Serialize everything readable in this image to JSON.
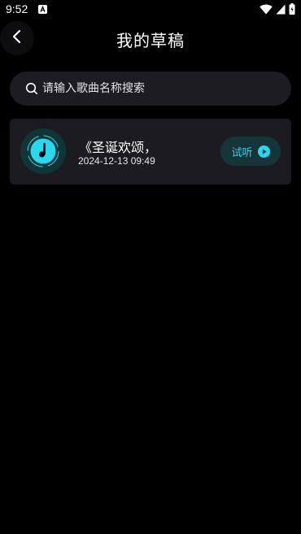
{
  "status_bar": {
    "time": "9:52",
    "app_icon": "a-box-icon",
    "indicators": [
      "wifi-icon",
      "signal-icon",
      "battery-icon"
    ]
  },
  "header": {
    "title": "我的草稿",
    "back_icon": "chevron-left-icon"
  },
  "search": {
    "placeholder": "请输入歌曲名称搜索",
    "value": "",
    "icon": "search-icon"
  },
  "drafts": [
    {
      "title": "《圣诞欢颂，",
      "date": "2024-12-13 09:49",
      "listen_label": "试听",
      "cover_icon": "music-disc-icon",
      "action_icon": "play-circle-icon"
    }
  ],
  "colors": {
    "background": "#000000",
    "card": "#1c1c20",
    "accent": "#27d9ee",
    "listen_button_bg": "#15353b"
  }
}
